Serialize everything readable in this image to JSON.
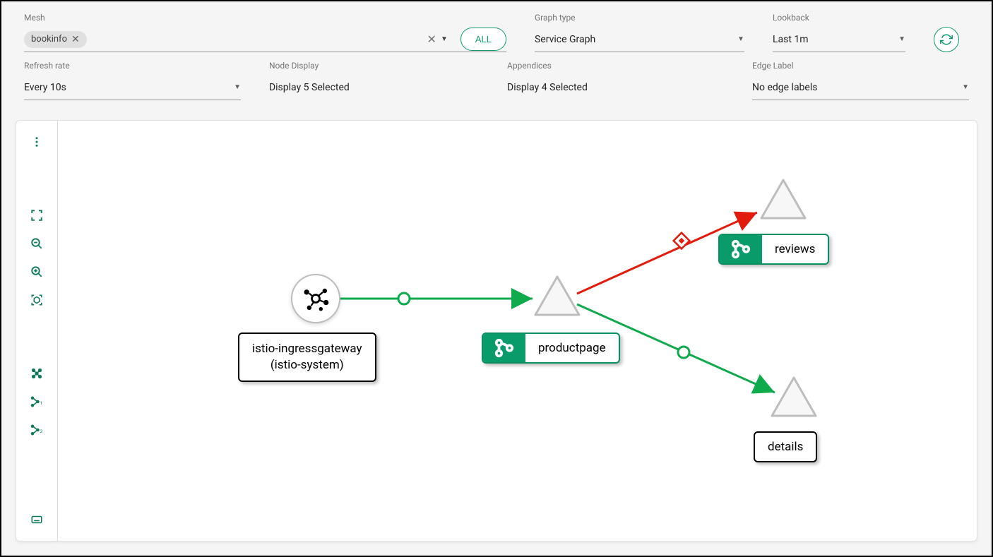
{
  "toolbar": {
    "row1": {
      "mesh": {
        "label": "Mesh",
        "chip": "bookinfo",
        "all_button": "ALL"
      },
      "graph_type": {
        "label": "Graph type",
        "value": "Service Graph"
      },
      "lookback": {
        "label": "Lookback",
        "value": "Last 1m"
      }
    },
    "row2": {
      "refresh_rate": {
        "label": "Refresh rate",
        "value": "Every 10s"
      },
      "node_display": {
        "label": "Node Display",
        "value": "Display 5 Selected"
      },
      "appendices": {
        "label": "Appendices",
        "value": "Display 4 Selected"
      },
      "edge_label": {
        "label": "Edge Label",
        "value": "No edge labels"
      }
    }
  },
  "graph": {
    "nodes": {
      "ingress": {
        "label_line1": "istio-ingressgateway",
        "label_line2": "(istio-system)"
      },
      "productpage": {
        "label": "productpage"
      },
      "reviews": {
        "label": "reviews"
      },
      "details": {
        "label": "details"
      }
    },
    "edges": [
      {
        "from": "ingress",
        "to": "productpage",
        "status": "ok"
      },
      {
        "from": "productpage",
        "to": "reviews",
        "status": "error"
      },
      {
        "from": "productpage",
        "to": "details",
        "status": "ok"
      }
    ]
  }
}
